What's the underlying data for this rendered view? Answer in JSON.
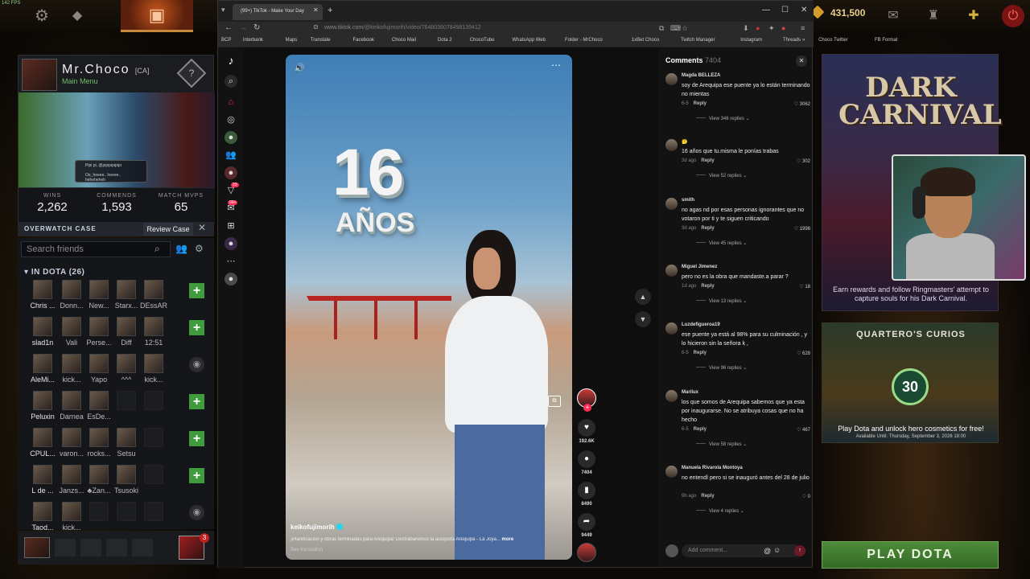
{
  "dota": {
    "fps": "142 FPS",
    "shards": "431,500",
    "profile": {
      "name": "Mr.Choco",
      "tag": "[CA]",
      "status": "Main Menu",
      "rank": "?"
    },
    "chat_lines": [
      "Pipi pi, @pipipipipipi",
      "Oe_heeee.. heeee.. heheheheh"
    ],
    "stats": [
      {
        "label": "WINS",
        "value": "2,262"
      },
      {
        "label": "COMMENDS",
        "value": "1,593"
      },
      {
        "label": "MATCH MVPS",
        "value": "65"
      }
    ],
    "overwatch": {
      "title": "OVERWATCH CASE",
      "button": "Review Case",
      "close": "✕"
    },
    "friends": {
      "search_placeholder": "Search friends",
      "group": "IN DOTA (26)",
      "rows": [
        {
          "names": [
            "Chris ...",
            "Donn...",
            "New...",
            "Starx...",
            "DEssAR"
          ],
          "action": "+"
        },
        {
          "names": [
            "slad1n",
            "Vali",
            "Perse...",
            "Diff",
            "12:51"
          ],
          "action": "+"
        },
        {
          "names": [
            "AleMi...",
            "kick...",
            "Yapo",
            "^^^",
            "kick..."
          ],
          "action": "◉"
        },
        {
          "names": [
            "Peluxin",
            "Darnea",
            "EsDe...",
            "",
            ""
          ],
          "action": "+"
        },
        {
          "names": [
            "CPUL...",
            "varon...",
            "rocks...",
            "Setsu",
            ""
          ],
          "action": "+"
        },
        {
          "names": [
            "L de ...",
            "Janzs...",
            "♣Zan...",
            "Tsusoki",
            ""
          ],
          "action": "+"
        },
        {
          "names": [
            "Taod...",
            "kick...",
            "",
            "",
            ""
          ],
          "action": "◉"
        }
      ]
    },
    "party_badge": "3",
    "carnival": {
      "title": "DARK CARNIVAL",
      "desc": "Earn rewards and follow Ringmasters' attempt to capture souls for his Dark Carnival."
    },
    "curios": {
      "title": "QUARTERO'S CURIOS",
      "number": "30",
      "desc": "Play Dota and unlock hero cosmetics for free!",
      "available": "Available Until:  Thursday, September 3, 2026 18:00"
    },
    "play_button": "PLAY DOTA"
  },
  "browser": {
    "tab_title": "(99+) TikTok - Make Your Day",
    "url_host": "www.tiktok.com",
    "url_path": "/@keikofujimorih/video/7648036078498139412",
    "bookmarks": [
      "BCP",
      "Interbank",
      "Maps",
      "Translate",
      "Facebook",
      "Choco Mail",
      "Dota 2",
      "ChocoTube",
      "WhatsApp Web",
      "Folder - MrChoco",
      "1xBet Choco",
      "Twitch Manager",
      "Instagram",
      "Threads",
      "Choco Twitter",
      "FB Format"
    ]
  },
  "tiktok": {
    "nav_badges": {
      "inbox": "23",
      "messages": "99+"
    },
    "video": {
      "overlay_number": "16",
      "overlay_word": "AÑOS",
      "author": "keikofujimorih",
      "caption": "¡Planificación y obras terminadas para Arequipa! Destrabaremos la autopista Arequipa - La Joya...",
      "more": "more",
      "see_translation": "See translation"
    },
    "actions": {
      "likes": "192.6K",
      "comments": "7404",
      "saves": "8490",
      "shares": "9449"
    },
    "comments_header": {
      "label": "Comments",
      "count": "7404"
    },
    "comments": [
      {
        "user": "Magda BELLEZA",
        "text": "soy de Arequipa ese puente ya lo están terminando no mientas",
        "date": "6-5",
        "likes": "3062",
        "replies": "View 346 replies"
      },
      {
        "user": "🤔",
        "text": "16 años que tu.misma le ponías trabas",
        "date": "3d ago",
        "likes": "302",
        "replies": "View 52 replies"
      },
      {
        "user": "smith",
        "text": "no agas nd por esas personas ignorantes que no votaron por ti y te siguen criticando",
        "date": "3d ago",
        "likes": "1998",
        "replies": "View 45 replies"
      },
      {
        "user": "Miguel Jimenez",
        "text": "pero no es la obra que mandaste.a parar ?",
        "date": "1d ago",
        "likes": "18",
        "replies": "View 13 replies"
      },
      {
        "user": "Luzdefigueroa19",
        "text": "ese puente ya está al 98% para su culminación , y lo hicieron sin la señora k ,",
        "date": "6-5",
        "likes": "628",
        "replies": "View 96 replies"
      },
      {
        "user": "Marilux",
        "text": "los que somos de Arequipa sabemos que ya esta por inaugurarse. No se atribuya cosas que no ha hecho",
        "date": "6-5",
        "likes": "467",
        "replies": "View 58 replies"
      },
      {
        "user": "Manuela Rivarola Montoya",
        "text": "no entendí pero si se inauguró antes del 28 de julio",
        "date": "9h ago",
        "likes": "0",
        "replies": "View 4 replies"
      }
    ],
    "reply_label": "Reply",
    "add_comment_placeholder": "Add comment..."
  }
}
